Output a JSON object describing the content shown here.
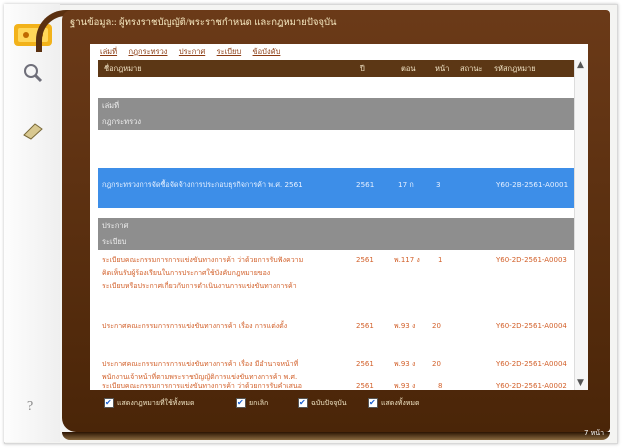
{
  "title": "ฐานข้อมูล:: ผู้ทรงราชบัญญัติ/พระราชกำหนด และกฎหมายปัจจุบัน",
  "nav_links": [
    "เล่มที่",
    "กฎกระทรวง",
    "ประกาศ",
    "ระเบียบ",
    "ข้อบังคับ"
  ],
  "table": {
    "headers": {
      "name": "ชื่อกฎหมาย",
      "year": "ปี",
      "volume": "ตอน",
      "page": "หน้า",
      "status": "สถานะ",
      "code": "รหัสกฎหมาย"
    },
    "groups": {
      "book": "เล่มที่",
      "ministerial": "กฎกระทรวง",
      "announcement": "ประกาศ",
      "regulation": "ระเบียบ"
    },
    "selected": {
      "name": "กฎกระทรวงการจัดซื้อจัดจ้างการประกอบธุรกิจการค้า พ.ศ. 2561",
      "year": "2561",
      "volume": "17 ก",
      "page": "3",
      "code": "Y60-2B-2561-A0001"
    },
    "rows": [
      {
        "lines": [
          "ระเบียบคณะกรรมการการแข่งขันทางการค้า ว่าด้วยการรับฟังความ",
          "คิดเห็นรับผู้ร้องเรียนในการประกาศใช้บังคับกฎหมายของ",
          "ระเบียบหรือประกาศเกี่ยวกับการดำเนินงานการแข่งขันทางการค้า"
        ],
        "year": "2561",
        "volume": "พ.117 ง",
        "page": "1",
        "code": "Y60-2D-2561-A0003"
      },
      {
        "lines": [
          "ประกาศคณะกรรมการการแข่งขันทางการค้า เรื่อง การแต่งตั้ง"
        ],
        "year": "2561",
        "volume": "พ.93 ง",
        "page": "20",
        "code": "Y60-2D-2561-A0004"
      },
      {
        "lines": [
          "ประกาศคณะกรรมการการแข่งขันทางการค้า เรื่อง มีอำนาจหน้าที่",
          "พนักงานเจ้าหน้าที่ตามพระราชบัญญัติการแข่งขันทางการค้า พ.ศ."
        ],
        "year": "2561",
        "volume": "พ.93 ง",
        "page": "20",
        "code": "Y60-2D-2561-A0004"
      },
      {
        "lines": [
          "ระเบียบคณะกรรมการการแข่งขันทางการค้า ว่าด้วยการรับคำเสนอ"
        ],
        "year": "2561",
        "volume": "พ.93 ง",
        "page": "8",
        "code": "Y60-2D-2561-A0002"
      }
    ]
  },
  "footer": {
    "items": [
      "แสดงกฎหมายที่ใช้ทั้งหมด",
      "ยกเลิก",
      "ฉบับปัจจุบัน",
      "แสดงทั้งหมด"
    ]
  },
  "page_tag": "7 หน้า",
  "icons": {
    "search": "magnifier-icon",
    "book": "book-icon",
    "help": "help-icon"
  }
}
